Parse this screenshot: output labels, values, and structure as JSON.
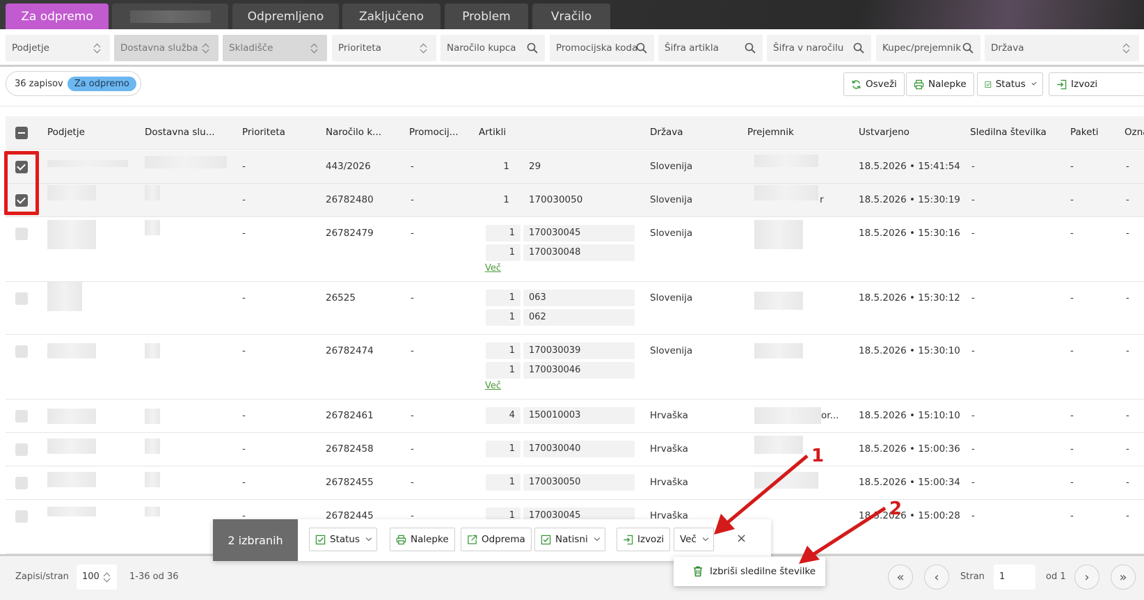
{
  "tabs": [
    {
      "label": "Za odpremo",
      "active": true
    },
    {
      "label": "",
      "blurred": true
    },
    {
      "label": "Odpremljeno"
    },
    {
      "label": "Zaključeno"
    },
    {
      "label": "Problem"
    },
    {
      "label": "Vračilo"
    }
  ],
  "filters": {
    "podjetje": "Podjetje",
    "dostavna": "Dostavna služba",
    "skladisce": "Skladišče",
    "prioriteta": "Prioriteta",
    "narocilo": "Naročilo kupca",
    "promocijska": "Promocijska koda",
    "sifra_artikla": "Šifra artikla",
    "sifra_narocilu": "Šifra v naročilu",
    "kupec": "Kupec/prejemnik",
    "drzava": "Država"
  },
  "records": {
    "count": "36 zapisov",
    "pill": "Za odpremo"
  },
  "toolbar": {
    "osvezi": "Osveži",
    "nalepke": "Nalepke",
    "status": "Status",
    "izvozi": "Izvozi"
  },
  "columns": {
    "podjetje": "Podjetje",
    "dostavna": "Dostavna slu...",
    "prioriteta": "Prioriteta",
    "narocilo": "Naročilo k...",
    "promocij": "Promocij...",
    "artikli": "Artikli",
    "drzava": "Država",
    "prejemnik": "Prejemnik",
    "ustvarjeno": "Ustvarjeno",
    "sledilna": "Sledilna številka",
    "paketi": "Paketi",
    "ozn": "Ozna"
  },
  "rows": [
    {
      "prio": "-",
      "order": "443/2026",
      "promo": "-",
      "items": [
        {
          "q": "1",
          "c": "29"
        }
      ],
      "more": "",
      "country": "Slovenija",
      "created": "18.5.2026 • 15:41:54",
      "tracking": "-",
      "packages": "-",
      "mark": "-"
    },
    {
      "prio": "-",
      "order": "26782480",
      "promo": "-",
      "items": [
        {
          "q": "1",
          "c": "170030050"
        }
      ],
      "more": "",
      "country": "Slovenija",
      "created": "18.5.2026 • 15:30:19",
      "tracking": "-",
      "packages": "-",
      "mark": "-",
      "recv_suffix": "r"
    },
    {
      "prio": "-",
      "order": "26782479",
      "promo": "-",
      "items": [
        {
          "q": "1",
          "c": "170030045"
        },
        {
          "q": "1",
          "c": "170030048"
        }
      ],
      "more": "Več",
      "country": "Slovenija",
      "created": "18.5.2026 • 15:30:16",
      "tracking": "-",
      "packages": "-",
      "mark": "-"
    },
    {
      "prio": "-",
      "order": "26525",
      "promo": "-",
      "items": [
        {
          "q": "1",
          "c": "063"
        },
        {
          "q": "1",
          "c": "062"
        }
      ],
      "more": "",
      "country": "Slovenija",
      "created": "18.5.2026 • 15:30:12",
      "tracking": "-",
      "packages": "-",
      "mark": "-"
    },
    {
      "prio": "-",
      "order": "26782474",
      "promo": "-",
      "items": [
        {
          "q": "1",
          "c": "170030039"
        },
        {
          "q": "1",
          "c": "170030046"
        }
      ],
      "more": "Več",
      "country": "Slovenija",
      "created": "18.5.2026 • 15:30:10",
      "tracking": "-",
      "packages": "-",
      "mark": "-"
    },
    {
      "prio": "-",
      "order": "26782461",
      "promo": "-",
      "items": [
        {
          "q": "4",
          "c": "150010003"
        }
      ],
      "more": "",
      "country": "Hrvaška",
      "created": "18.5.2026 • 15:10:10",
      "tracking": "-",
      "packages": "-",
      "mark": "-",
      "recv_suffix": "or..."
    },
    {
      "prio": "-",
      "order": "26782458",
      "promo": "-",
      "items": [
        {
          "q": "1",
          "c": "170030040"
        }
      ],
      "more": "",
      "country": "Hrvaška",
      "created": "18.5.2026 • 15:00:36",
      "tracking": "-",
      "packages": "-",
      "mark": "-"
    },
    {
      "prio": "-",
      "order": "26782455",
      "promo": "-",
      "items": [
        {
          "q": "1",
          "c": "170030050"
        }
      ],
      "more": "",
      "country": "Hrvaška",
      "created": "18.5.2026 • 15:00:34",
      "tracking": "-",
      "packages": "-",
      "mark": "-"
    },
    {
      "prio": "-",
      "order": "26782445",
      "promo": "-",
      "items": [
        {
          "q": "1",
          "c": "170030045"
        }
      ],
      "more": "",
      "country": "Hrvaška",
      "created": "18.5.2026 • 15:00:28",
      "tracking": "-",
      "packages": "-",
      "mark": "-"
    }
  ],
  "actionbar": {
    "count": "2 izbranih",
    "status": "Status",
    "nalepke": "Nalepke",
    "odprema": "Odprema",
    "natisni": "Natisni",
    "izvozi": "Izvozi",
    "vec": "Več",
    "close": "×"
  },
  "dropdown": {
    "delete_tracking": "Izbriši sledilne številke"
  },
  "pagination": {
    "per_page_label": "Zapisi/stran",
    "per_page": "100",
    "range": "1-36 od 36",
    "page_label": "Stran",
    "page": "1",
    "of": "od 1"
  },
  "annotations": {
    "one": "1",
    "two": "2"
  },
  "colors": {
    "accent": "#c25ad0",
    "pill": "#6cb7f0",
    "highlight": "#e11a1a",
    "link": "#4a9a3b"
  }
}
